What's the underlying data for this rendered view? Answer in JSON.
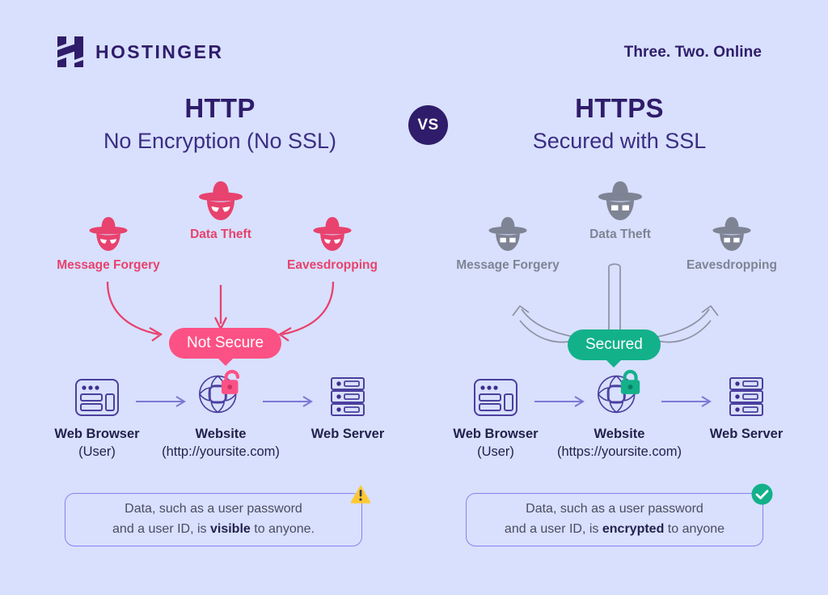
{
  "brand": {
    "name": "HOSTINGER",
    "logo_icon": "hostinger-h-logo",
    "tagline": "Three. Two. Online"
  },
  "vs_badge": "VS",
  "colors": {
    "background": "#d8e0fd",
    "brand_purple": "#2f1c6a",
    "danger_pink": "#e8426e",
    "pill_pink": "#fc5185",
    "secure_green": "#13b18a",
    "muted_gray": "#7f8495",
    "border_purple": "#8c7ff0",
    "warning_yellow": "#ffc933"
  },
  "columns": [
    {
      "id": "http",
      "title": "HTTP",
      "subtitle": "No Encryption (No SSL)",
      "state": "insecure",
      "threats": [
        {
          "id": "data-theft",
          "label": "Data Theft",
          "icon": "spy-hat-icon"
        },
        {
          "id": "message-forgery",
          "label": "Message Forgery",
          "icon": "spy-hat-icon"
        },
        {
          "id": "eavesdropping",
          "label": "Eavesdropping",
          "icon": "spy-hat-icon"
        }
      ],
      "status_pill": "Not Secure",
      "nodes": [
        {
          "id": "web-browser",
          "icon": "browser-window-icon",
          "line1": "Web Browser",
          "line2": "(User)"
        },
        {
          "id": "website",
          "icon": "globe-icon",
          "line1": "Website",
          "line2": "(http://yoursite.com)",
          "lock": "unlocked-padlock-icon"
        },
        {
          "id": "web-server",
          "icon": "server-stack-icon",
          "line1": "Web Server",
          "line2": ""
        }
      ],
      "note": {
        "line1": "Data, such as a user password",
        "line2_pre": "and a user ID, is ",
        "line2_strong": "visible",
        "line2_post": " to anyone.",
        "badge": "warning-triangle-icon"
      }
    },
    {
      "id": "https",
      "title": "HTTPS",
      "subtitle": "Secured with SSL",
      "state": "secure",
      "threats": [
        {
          "id": "data-theft",
          "label": "Data Theft",
          "icon": "spy-hat-blocked-icon"
        },
        {
          "id": "message-forgery",
          "label": "Message Forgery",
          "icon": "spy-hat-blocked-icon"
        },
        {
          "id": "eavesdropping",
          "label": "Eavesdropping",
          "icon": "spy-hat-blocked-icon"
        }
      ],
      "status_pill": "Secured",
      "nodes": [
        {
          "id": "web-browser",
          "icon": "browser-window-icon",
          "line1": "Web Browser",
          "line2": "(User)"
        },
        {
          "id": "website",
          "icon": "globe-icon",
          "line1": "Website",
          "line2": "(https://yoursite.com)",
          "lock": "locked-padlock-icon"
        },
        {
          "id": "web-server",
          "icon": "server-stack-icon",
          "line1": "Web Server",
          "line2": ""
        }
      ],
      "note": {
        "line1": "Data, such as a user password",
        "line2_pre": "and a user ID, is ",
        "line2_strong": "encrypted",
        "line2_post": " to anyone",
        "badge": "check-circle-icon"
      }
    }
  ]
}
